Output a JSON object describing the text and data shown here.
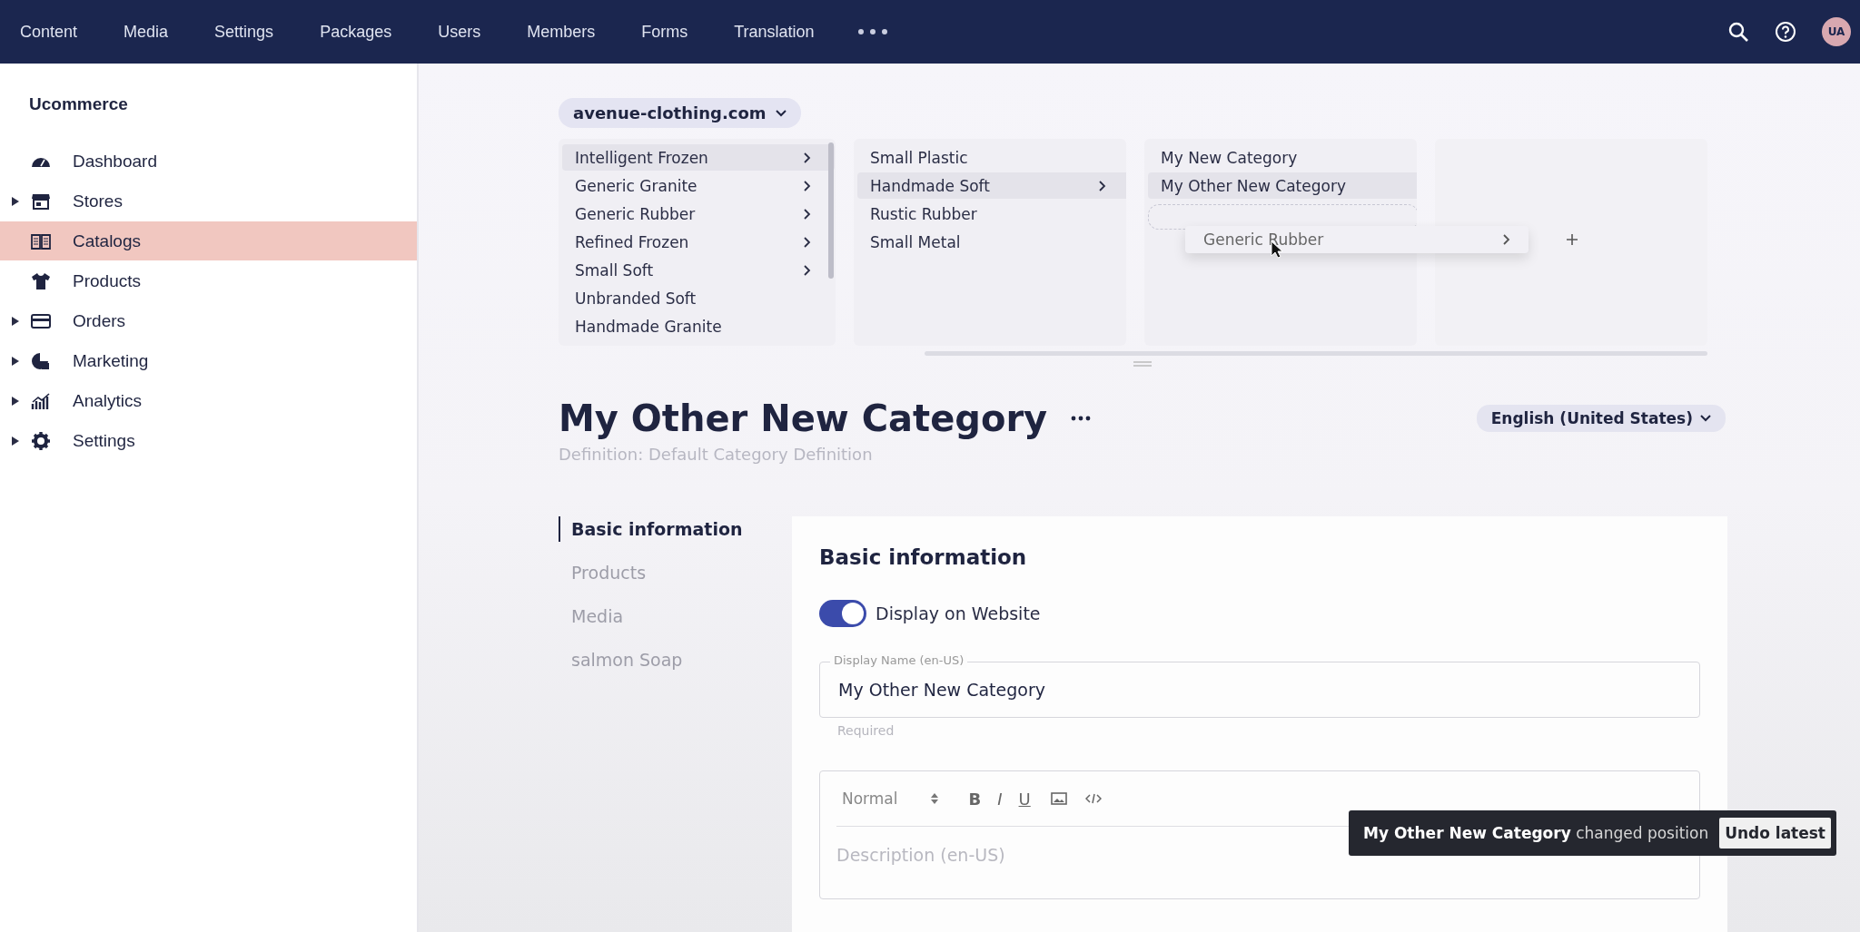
{
  "top_nav": {
    "items": [
      {
        "label": "Content"
      },
      {
        "label": "Media"
      },
      {
        "label": "Settings"
      },
      {
        "label": "Packages"
      },
      {
        "label": "Users"
      },
      {
        "label": "Members"
      },
      {
        "label": "Forms"
      },
      {
        "label": "Translation"
      }
    ],
    "avatar": "UA"
  },
  "sidebar": {
    "title": "Ucommerce",
    "items": [
      {
        "label": "Dashboard",
        "expandable": false,
        "selected": false
      },
      {
        "label": "Stores",
        "expandable": true,
        "selected": false
      },
      {
        "label": "Catalogs",
        "expandable": false,
        "selected": true
      },
      {
        "label": "Products",
        "expandable": false,
        "selected": false
      },
      {
        "label": "Orders",
        "expandable": true,
        "selected": false
      },
      {
        "label": "Marketing",
        "expandable": true,
        "selected": false
      },
      {
        "label": "Analytics",
        "expandable": true,
        "selected": false
      },
      {
        "label": "Settings",
        "expandable": true,
        "selected": false
      }
    ]
  },
  "store_picker": "avenue-clothing.com",
  "columns": [
    {
      "items": [
        {
          "label": "Intelligent Frozen",
          "has_children": true,
          "selected": true
        },
        {
          "label": "Generic Granite",
          "has_children": true,
          "selected": false
        },
        {
          "label": "Generic Rubber",
          "has_children": true,
          "selected": false
        },
        {
          "label": "Refined Frozen",
          "has_children": true,
          "selected": false
        },
        {
          "label": "Small Soft",
          "has_children": true,
          "selected": false
        },
        {
          "label": "Unbranded Soft",
          "has_children": false,
          "selected": false
        },
        {
          "label": "Handmade Granite",
          "has_children": false,
          "selected": false
        }
      ]
    },
    {
      "items": [
        {
          "label": "Small Plastic",
          "has_children": false,
          "selected": false
        },
        {
          "label": "Handmade Soft",
          "has_children": true,
          "selected": true
        },
        {
          "label": "Rustic Rubber",
          "has_children": false,
          "selected": false
        },
        {
          "label": "Small Metal",
          "has_children": false,
          "selected": false
        }
      ]
    },
    {
      "items": [
        {
          "label": "My New Category",
          "has_children": false,
          "selected": false
        },
        {
          "label": "My Other New Category",
          "has_children": false,
          "selected": true
        }
      ]
    }
  ],
  "dragged_item": {
    "label": "Generic Rubber",
    "has_children": true
  },
  "header": {
    "title": "My Other New Category",
    "subtitle": "Definition: Default Category Definition",
    "language": "English (United States)"
  },
  "sections": [
    {
      "label": "Basic information",
      "selected": true
    },
    {
      "label": "Products",
      "selected": false
    },
    {
      "label": "Media",
      "selected": false
    },
    {
      "label": "salmon Soap",
      "selected": false
    }
  ],
  "card": {
    "title": "Basic information",
    "toggle": {
      "label": "Display on Website",
      "on": true
    },
    "display_name": {
      "label": "Display Name (en-US)",
      "value": "My Other New Category",
      "hint": "Required"
    },
    "editor": {
      "format": "Normal",
      "bold": "B",
      "italic": "I",
      "underline": "U",
      "placeholder": "Description (en-US)"
    }
  },
  "toast": {
    "message": "**My Other New Category** changed position",
    "action": "Undo latest"
  }
}
